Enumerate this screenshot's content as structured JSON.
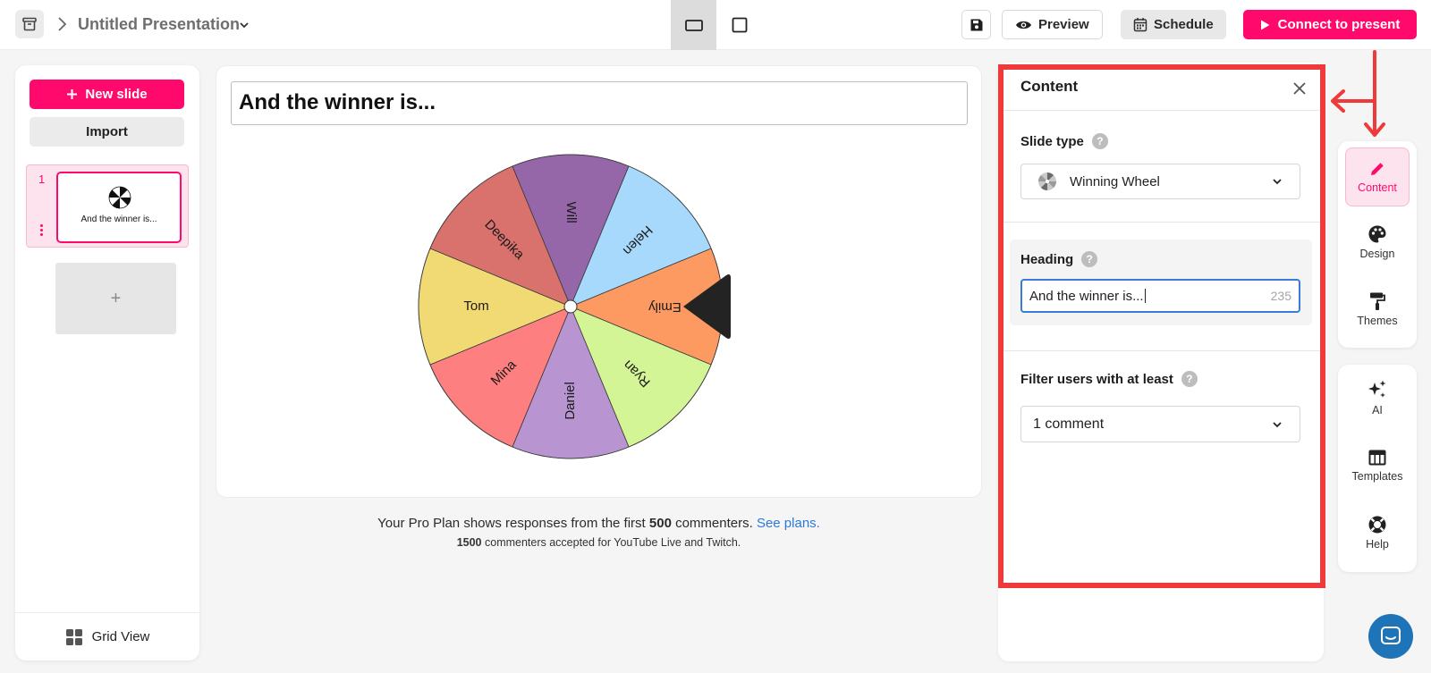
{
  "topbar": {
    "presentation_title": "Untitled Presentation",
    "preview_label": "Preview",
    "schedule_label": "Schedule",
    "present_label": "Connect to present"
  },
  "left_panel": {
    "new_slide_label": "New slide",
    "import_label": "Import",
    "slides": [
      {
        "number": "1",
        "title": "And the winner is..."
      }
    ],
    "add_slide_label": "+",
    "grid_view_label": "Grid View"
  },
  "canvas": {
    "heading": "And the winner is...",
    "wheel": {
      "segments": [
        {
          "name": "Emily",
          "color": "#fd9a61"
        },
        {
          "name": "Ryan",
          "color": "#d4f595"
        },
        {
          "name": "Daniel",
          "color": "#b894d0"
        },
        {
          "name": "Mina",
          "color": "#fd7f7f"
        },
        {
          "name": "Tom",
          "color": "#f1da74"
        },
        {
          "name": "Deepika",
          "color": "#d9716d"
        },
        {
          "name": "Will",
          "color": "#9567a9"
        },
        {
          "name": "Helen",
          "color": "#a7d9fc"
        }
      ],
      "pointer_color": "#232323"
    },
    "plan_note_prefix": "Your Pro Plan shows responses from the first ",
    "plan_note_count": "500",
    "plan_note_suffix": " commenters. ",
    "plan_note_link": "See plans.",
    "plan_sub_count": "1500",
    "plan_sub_text": " commenters accepted for YouTube Live and Twitch."
  },
  "content_panel": {
    "title": "Content",
    "slide_type_label": "Slide type",
    "slide_type_value": "Winning Wheel",
    "heading_label": "Heading",
    "heading_value": "And the winner is...",
    "heading_counter": "235",
    "filter_label": "Filter users with at least",
    "filter_value": "1 comment",
    "help_glyph": "?"
  },
  "right_rail": {
    "items_top": [
      {
        "label": "Content",
        "icon": "pencil-icon"
      },
      {
        "label": "Design",
        "icon": "palette-icon"
      },
      {
        "label": "Themes",
        "icon": "paint-roller-icon"
      }
    ],
    "items_bottom": [
      {
        "label": "AI",
        "icon": "sparkles-icon"
      },
      {
        "label": "Templates",
        "icon": "templates-icon"
      },
      {
        "label": "Help",
        "icon": "lifebuoy-icon"
      }
    ]
  },
  "colors": {
    "brand": "#ff0a6c",
    "highlight_outline": "#ee3a3a",
    "link": "#2f79d7",
    "focus": "#3a7bd5",
    "chat": "#1f73b7"
  }
}
